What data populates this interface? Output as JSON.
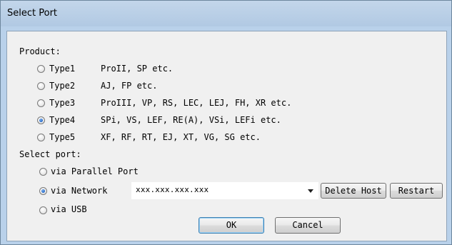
{
  "window": {
    "title": "Select Port"
  },
  "product": {
    "label": "Product:",
    "selected": "Type4",
    "options": [
      {
        "type": "Type1",
        "desc": "ProII, SP etc."
      },
      {
        "type": "Type2",
        "desc": "AJ, FP etc."
      },
      {
        "type": "Type3",
        "desc": "ProIII, VP, RS, LEC, LEJ, FH, XR etc."
      },
      {
        "type": "Type4",
        "desc": "SPi, VS, LEF, RE(A), VSi, LEFi etc."
      },
      {
        "type": "Type5",
        "desc": "XF, RF, RT, EJ, XT, VG, SG etc."
      }
    ]
  },
  "port": {
    "label": "Select port:",
    "selected": "via Network",
    "options": [
      "via Parallel Port",
      "via Network",
      "via USB"
    ],
    "host_value": "xxx.xxx.xxx.xxx",
    "delete_host_label": "Delete Host",
    "restart_label": "Restart"
  },
  "buttons": {
    "ok": "OK",
    "cancel": "Cancel"
  }
}
